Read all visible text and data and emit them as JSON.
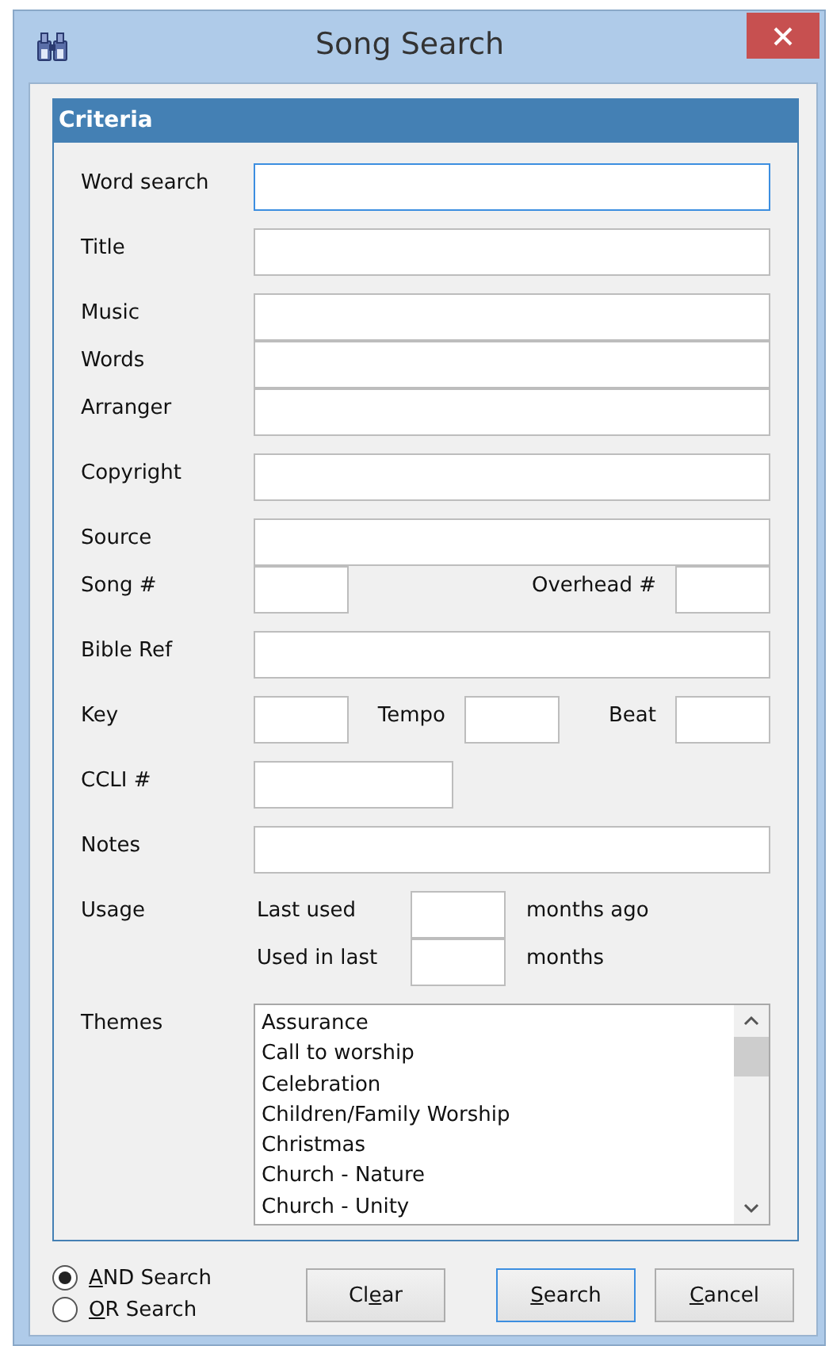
{
  "window": {
    "title": "Song Search"
  },
  "criteria": {
    "title": "Criteria",
    "groups": [
      [
        {
          "kind": "wide",
          "label": "Word search",
          "focused": true
        }
      ],
      [
        {
          "kind": "wide",
          "label": "Title",
          "focused": false
        }
      ],
      [
        {
          "kind": "wide",
          "label": "Music",
          "focused": false
        },
        {
          "kind": "wide",
          "label": "Words",
          "focused": false
        },
        {
          "kind": "wide",
          "label": "Arranger",
          "focused": false
        }
      ],
      [
        {
          "kind": "wide",
          "label": "Copyright",
          "focused": false
        }
      ],
      [
        {
          "kind": "wide",
          "label": "Source",
          "focused": false
        },
        {
          "kind": "split",
          "label": "Song #",
          "inner_labels": [
            "Overhead #"
          ]
        }
      ],
      [
        {
          "kind": "wide",
          "label": "Bible Ref",
          "focused": false
        }
      ],
      [
        {
          "kind": "split",
          "label": "Key",
          "inner_labels": [
            "Tempo",
            "Beat"
          ]
        }
      ],
      [
        {
          "kind": "medium",
          "label": "CCLI #"
        }
      ],
      [
        {
          "kind": "wide",
          "label": "Notes",
          "focused": false
        }
      ],
      [
        {
          "kind": "usage",
          "label": "Usage",
          "lines": [
            {
              "label": "Last used",
              "suffix": "months ago"
            },
            {
              "label": "Used in last",
              "suffix": "months"
            }
          ]
        }
      ],
      [
        {
          "kind": "list",
          "label": "Themes",
          "items": [
            "Assurance",
            "Call to worship",
            "Celebration",
            "Children/Family Worship",
            "Christmas",
            "Church - Nature",
            "Church - Unity"
          ]
        }
      ]
    ]
  },
  "search_mode": [
    {
      "label_parts": [
        {
          "text": "A",
          "underlined": true
        },
        {
          "text": "ND Search",
          "underlined": false
        }
      ],
      "selected": true
    },
    {
      "label_parts": [
        {
          "text": "O",
          "underlined": true
        },
        {
          "text": "R Search",
          "underlined": false
        }
      ],
      "selected": false
    }
  ],
  "buttons": [
    {
      "label_parts": [
        {
          "text": "Cl",
          "underlined": false
        },
        {
          "text": "e",
          "underlined": true
        },
        {
          "text": "ar",
          "underlined": false
        }
      ],
      "default": false
    },
    {
      "label_parts": [
        {
          "text": "S",
          "underlined": true
        },
        {
          "text": "earch",
          "underlined": false
        }
      ],
      "default": true
    },
    {
      "label_parts": [
        {
          "text": "C",
          "underlined": true
        },
        {
          "text": "ancel",
          "underlined": false
        }
      ],
      "default": false
    }
  ]
}
